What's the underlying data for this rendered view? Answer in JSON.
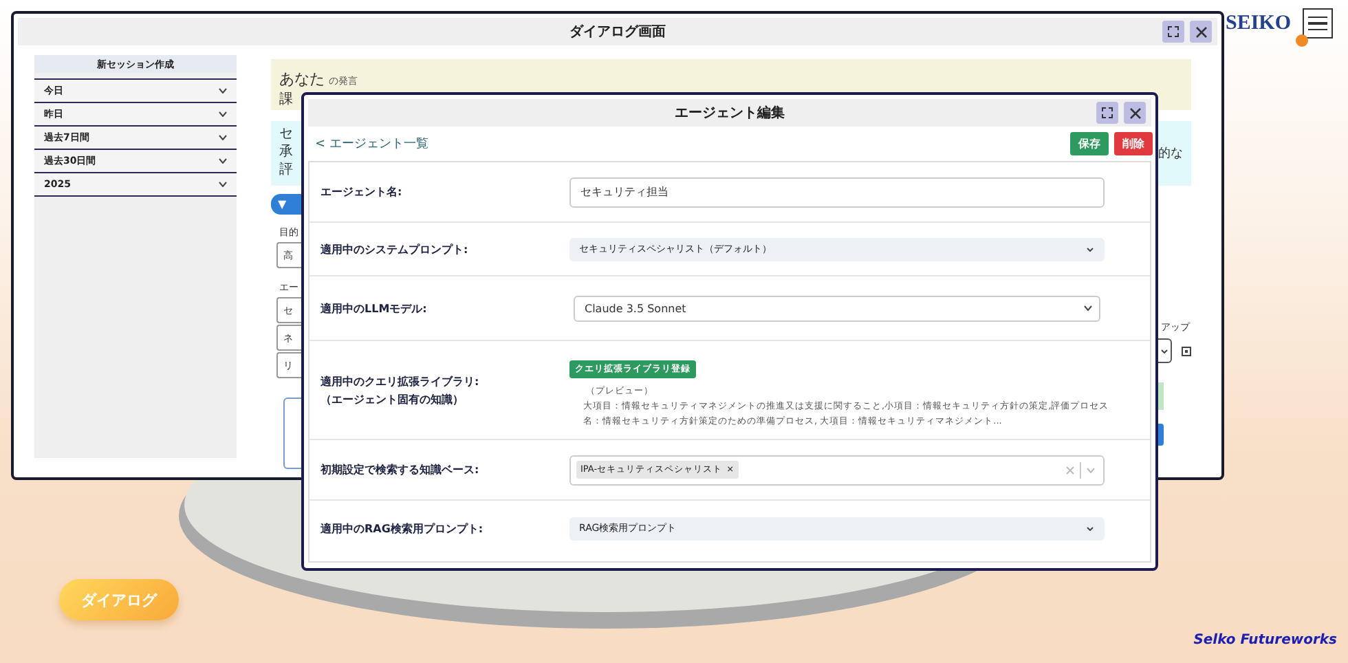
{
  "desktop": {
    "brand": "SEIKO",
    "dialog_button": "ダイアログ",
    "footer": "Selko Futureworks"
  },
  "main_window": {
    "title": "ダイアログ画面",
    "sidebar": {
      "new_session": "新セッション作成",
      "groups": [
        {
          "label": "今日"
        },
        {
          "label": "昨日"
        },
        {
          "label": "過去7日間"
        },
        {
          "label": "過去30日間"
        },
        {
          "label": "2025"
        }
      ]
    },
    "chat": {
      "user_message": {
        "speaker": "あなた",
        "suffix": "の発言",
        "text": "課"
      },
      "assistant_message": {
        "lines": [
          "セ",
          "承",
          "評"
        ],
        "right_text": "的な"
      },
      "section_toggle": "▼",
      "form_left": {
        "purpose_label": "目的",
        "purpose_value": "高",
        "agent_label": "エー",
        "agents": [
          "セ",
          "ネ",
          "リ"
        ]
      },
      "form_right": {
        "label": "アップ"
      }
    }
  },
  "agent_editor": {
    "title": "エージェント編集",
    "back_link": "< エージェント一覧",
    "buttons": [
      {
        "label": "保存",
        "kind": "save"
      },
      {
        "label": "削除",
        "kind": "delete"
      }
    ],
    "fields": [
      {
        "kind": "text",
        "label": [
          "エージェント名:"
        ],
        "value": "セキュリティ担当"
      },
      {
        "kind": "select",
        "label": [
          "適用中のシステムプロンプト:"
        ],
        "value": "セキュリティスペシャリスト（デフォルト）"
      },
      {
        "kind": "native_select",
        "label": [
          "適用中のLLMモデル:"
        ],
        "value": "Claude 3.5 Sonnet"
      },
      {
        "kind": "library",
        "label": [
          "適用中のクエリ拡張ライブラリ:",
          "（エージェント固有の知識）"
        ],
        "button": "クエリ拡張ライブラリ登録",
        "preview_title": "（プレビュー）",
        "preview": "大項目：情報セキュリティマネジメントの推進又は支援に関すること,小項目：情報セキュリティ方針の策定,評価プロセス名：情報セキュリティ方針策定のための準備プロセス, 大項目：情報セキュリティマネジメント..."
      },
      {
        "kind": "multiselect",
        "label": [
          "初期設定で検索する知識ベース:"
        ],
        "tags": [
          {
            "label": "IPA-セキュリティスペシャリスト",
            "remove": "×"
          }
        ]
      },
      {
        "kind": "select",
        "label": [
          "適用中のRAG検索用プロンプト:"
        ],
        "value": "RAG検索用プロンプト"
      }
    ]
  }
}
